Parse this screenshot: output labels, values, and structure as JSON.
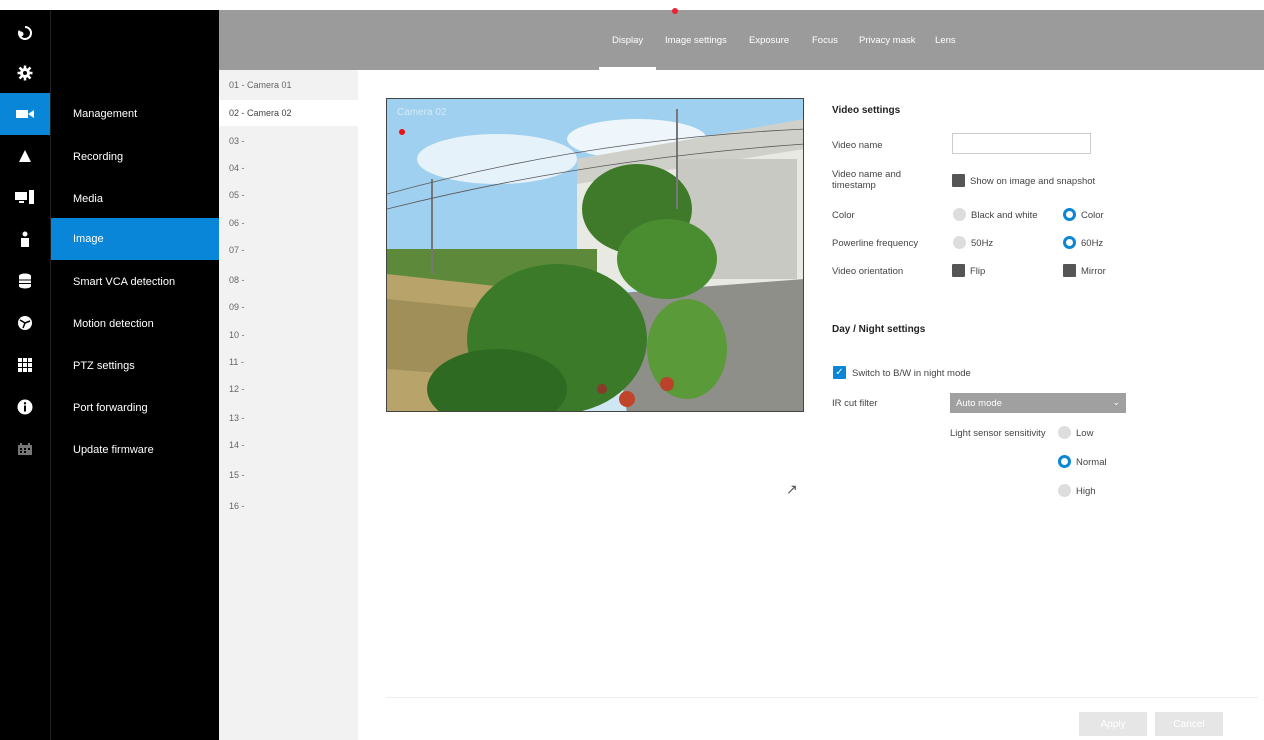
{
  "header": {
    "tabs": [
      {
        "label": "Display",
        "active": true
      },
      {
        "label": "Image settings",
        "active": false
      },
      {
        "label": "Exposure",
        "active": false
      },
      {
        "label": "Focus",
        "active": false
      },
      {
        "label": "Privacy mask",
        "active": false
      },
      {
        "label": "Lens",
        "active": false
      }
    ]
  },
  "icon_rail": {
    "icons": [
      "logout-icon",
      "gear-icon",
      "video-camera-icon",
      "alert-icon",
      "devices-icon",
      "user-icon",
      "database-icon",
      "network-icon",
      "apps-grid-icon",
      "info-icon",
      "calendar-icon"
    ]
  },
  "sidebar": {
    "items": [
      {
        "label": "Management"
      },
      {
        "label": "Recording"
      },
      {
        "label": "Media"
      },
      {
        "label": "Image",
        "active": true
      },
      {
        "label": "Smart VCA detection"
      },
      {
        "label": "Motion detection"
      },
      {
        "label": "PTZ settings"
      },
      {
        "label": "Port forwarding"
      },
      {
        "label": "Update firmware"
      }
    ]
  },
  "camera_list": [
    "01 - Camera 01",
    "02 - Camera 02",
    "03 -",
    "04 -",
    "05 -",
    "06 -",
    "07 -",
    "08 -",
    "09 -",
    "10 -",
    "11 -",
    "12 -",
    "13 -",
    "14 -",
    "15 -",
    "16 -"
  ],
  "preview": {
    "overlay_text": "Camera 02"
  },
  "video_settings": {
    "heading": "Video settings",
    "video_name_label": "Video name",
    "video_name_value": "",
    "timestamp_label": "Video name and timestamp",
    "timestamp_option": "Show on image and snapshot",
    "color_label": "Color",
    "color_options": [
      "Black and white",
      "Color"
    ],
    "color_selected": "Color",
    "powerline_label": "Powerline frequency",
    "powerline_options": [
      "50Hz",
      "60Hz"
    ],
    "powerline_selected": "60Hz",
    "orientation_label": "Video orientation",
    "orientation_options": [
      "Flip",
      "Mirror"
    ]
  },
  "day_night": {
    "heading": "Day / Night settings",
    "switch_label": "Switch to B/W in night mode",
    "switch_checked": true,
    "ir_label": "IR cut filter",
    "ir_value": "Auto mode",
    "sensitivity_label": "Light sensor sensitivity",
    "sensitivity_options": [
      "Low",
      "Normal",
      "High"
    ],
    "sensitivity_selected": "Normal"
  },
  "footer": {
    "apply_label": "Apply",
    "cancel_label": "Cancel"
  },
  "colors": {
    "accent": "#0a86d8",
    "header": "#9b9b9b",
    "sidebar": "#000000"
  }
}
